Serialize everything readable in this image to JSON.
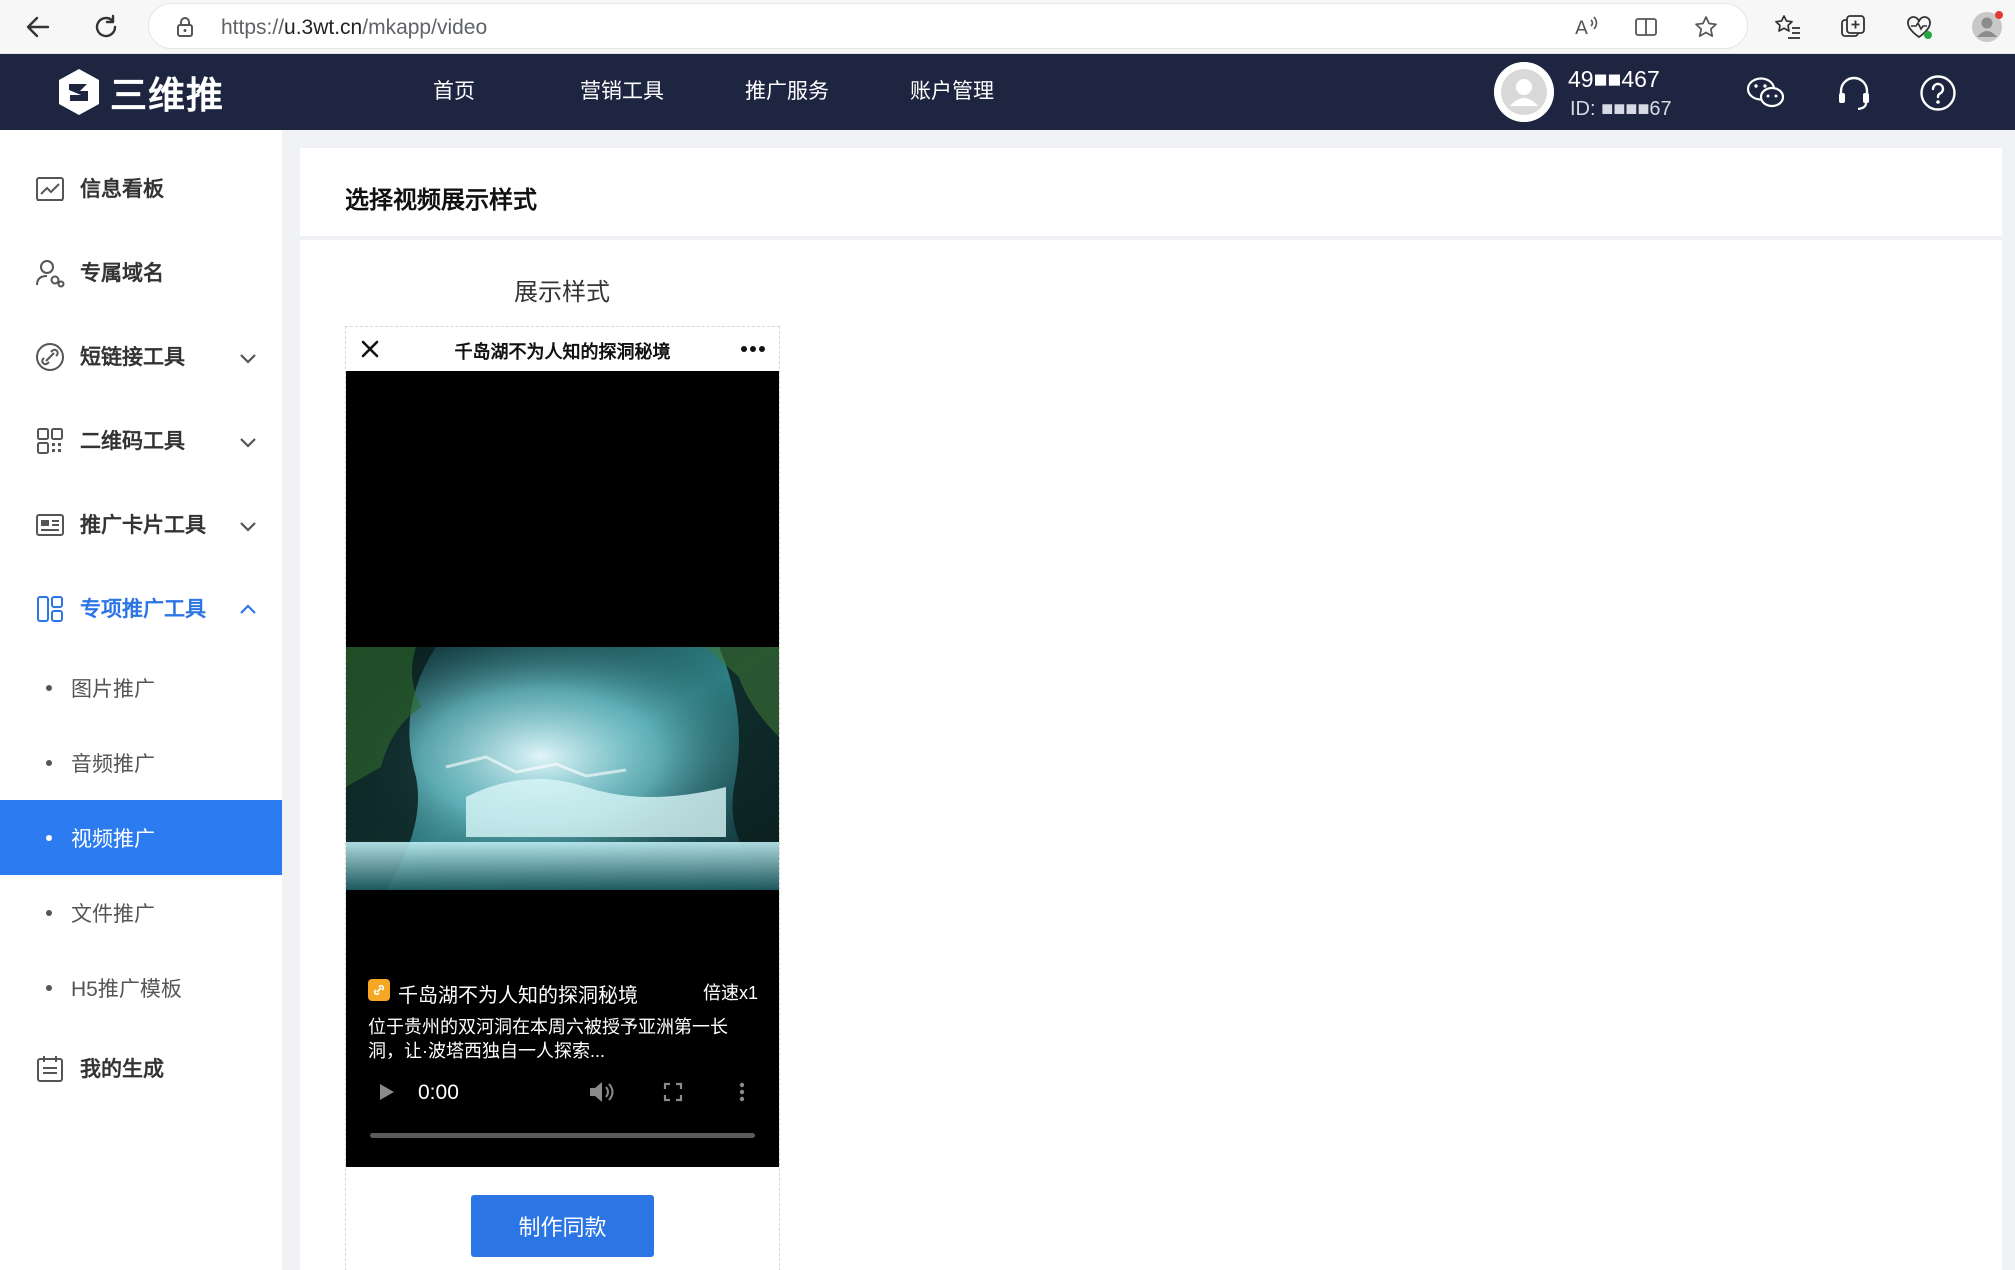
{
  "browser": {
    "url_prefix": "https://",
    "url_host": "u.3wt.cn",
    "url_path": "/mkapp/video"
  },
  "header": {
    "brand": "三维推",
    "nav": [
      "首页",
      "营销工具",
      "推广服务",
      "账户管理"
    ],
    "user_name": "49■■467",
    "user_id": "ID: ■■■■67"
  },
  "sidebar": {
    "items": [
      {
        "label": "信息看板",
        "icon": "dashboard-icon"
      },
      {
        "label": "专属域名",
        "icon": "user-link-icon"
      },
      {
        "label": "短链接工具",
        "icon": "link-icon"
      },
      {
        "label": "二维码工具",
        "icon": "qrcode-icon"
      },
      {
        "label": "推广卡片工具",
        "icon": "card-icon"
      },
      {
        "label": "专项推广工具",
        "icon": "layout-icon"
      }
    ],
    "sub_items": [
      "图片推广",
      "音频推广",
      "视频推广",
      "文件推广",
      "H5推广模板"
    ],
    "last_item": {
      "label": "我的生成",
      "icon": "calendar-list-icon"
    }
  },
  "main": {
    "page_title": "选择视频展示样式",
    "section_label": "展示样式",
    "card": {
      "phone_title": "千岛湖不为人知的探洞秘境",
      "video_title": "千岛湖不为人知的探洞秘境",
      "speed": "倍速x1",
      "description": "位于贵州的双河洞在本周六被授予亚洲第一长洞，让·波塔西独自一人探索...",
      "time": "0:00",
      "button": "制作同款"
    }
  },
  "colors": {
    "header_bg": "#1d2540",
    "accent": "#2c75e5",
    "selected_bg": "#2c7bf0"
  }
}
